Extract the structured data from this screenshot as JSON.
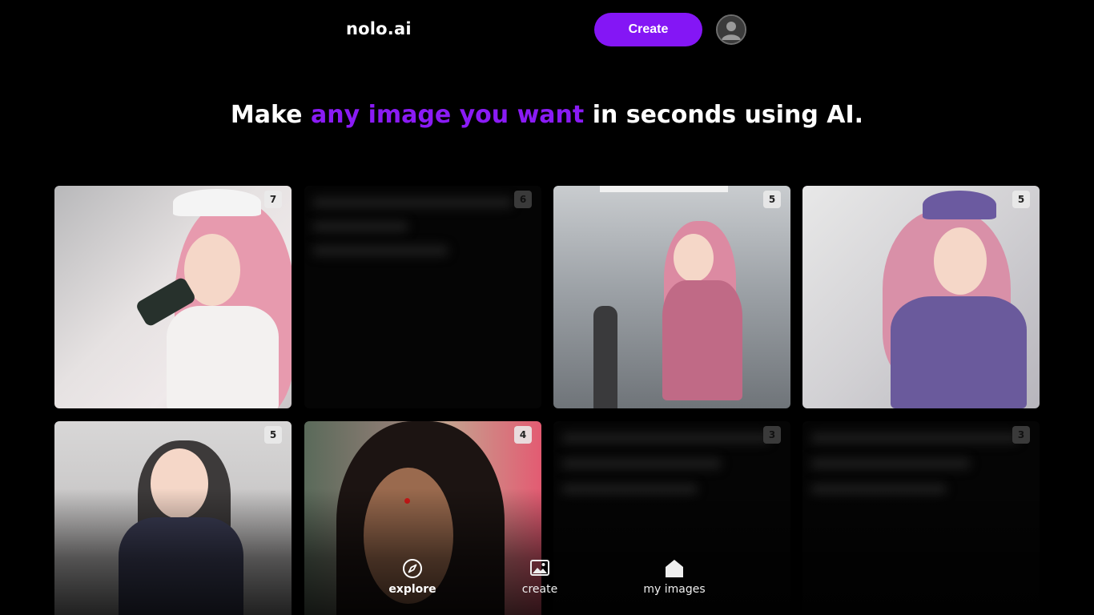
{
  "header": {
    "logo": "nolo.ai",
    "create_label": "Create"
  },
  "headline": {
    "before": "Make ",
    "accent": "any image you want",
    "after": " in seconds using AI.",
    "accent_color": "#8a1bf5"
  },
  "gallery": {
    "cards": [
      {
        "count": "7",
        "blurred": false,
        "subject": "pink-haired anime nurse holding camera"
      },
      {
        "count": "6",
        "blurred": true
      },
      {
        "count": "5",
        "blurred": false,
        "subject": "anime nurse in pink uniform in hospital corridor"
      },
      {
        "count": "5",
        "blurred": false,
        "subject": "anime nurse in purple uniform by window"
      },
      {
        "count": "5",
        "blurred": false,
        "subject": "dark-haired anime nurse in navy scrubs"
      },
      {
        "count": "4",
        "blurred": false,
        "subject": "portrait of a woman with bindi"
      },
      {
        "count": "3",
        "blurred": true
      },
      {
        "count": "3",
        "blurred": true
      }
    ]
  },
  "bottom_nav": {
    "items": [
      {
        "label": "explore",
        "icon": "compass-icon",
        "active": true
      },
      {
        "label": "create",
        "icon": "image-icon",
        "active": false
      },
      {
        "label": "my images",
        "icon": "home-icon",
        "active": false
      }
    ]
  },
  "colors": {
    "accent": "#8416f5",
    "background": "#000000"
  }
}
